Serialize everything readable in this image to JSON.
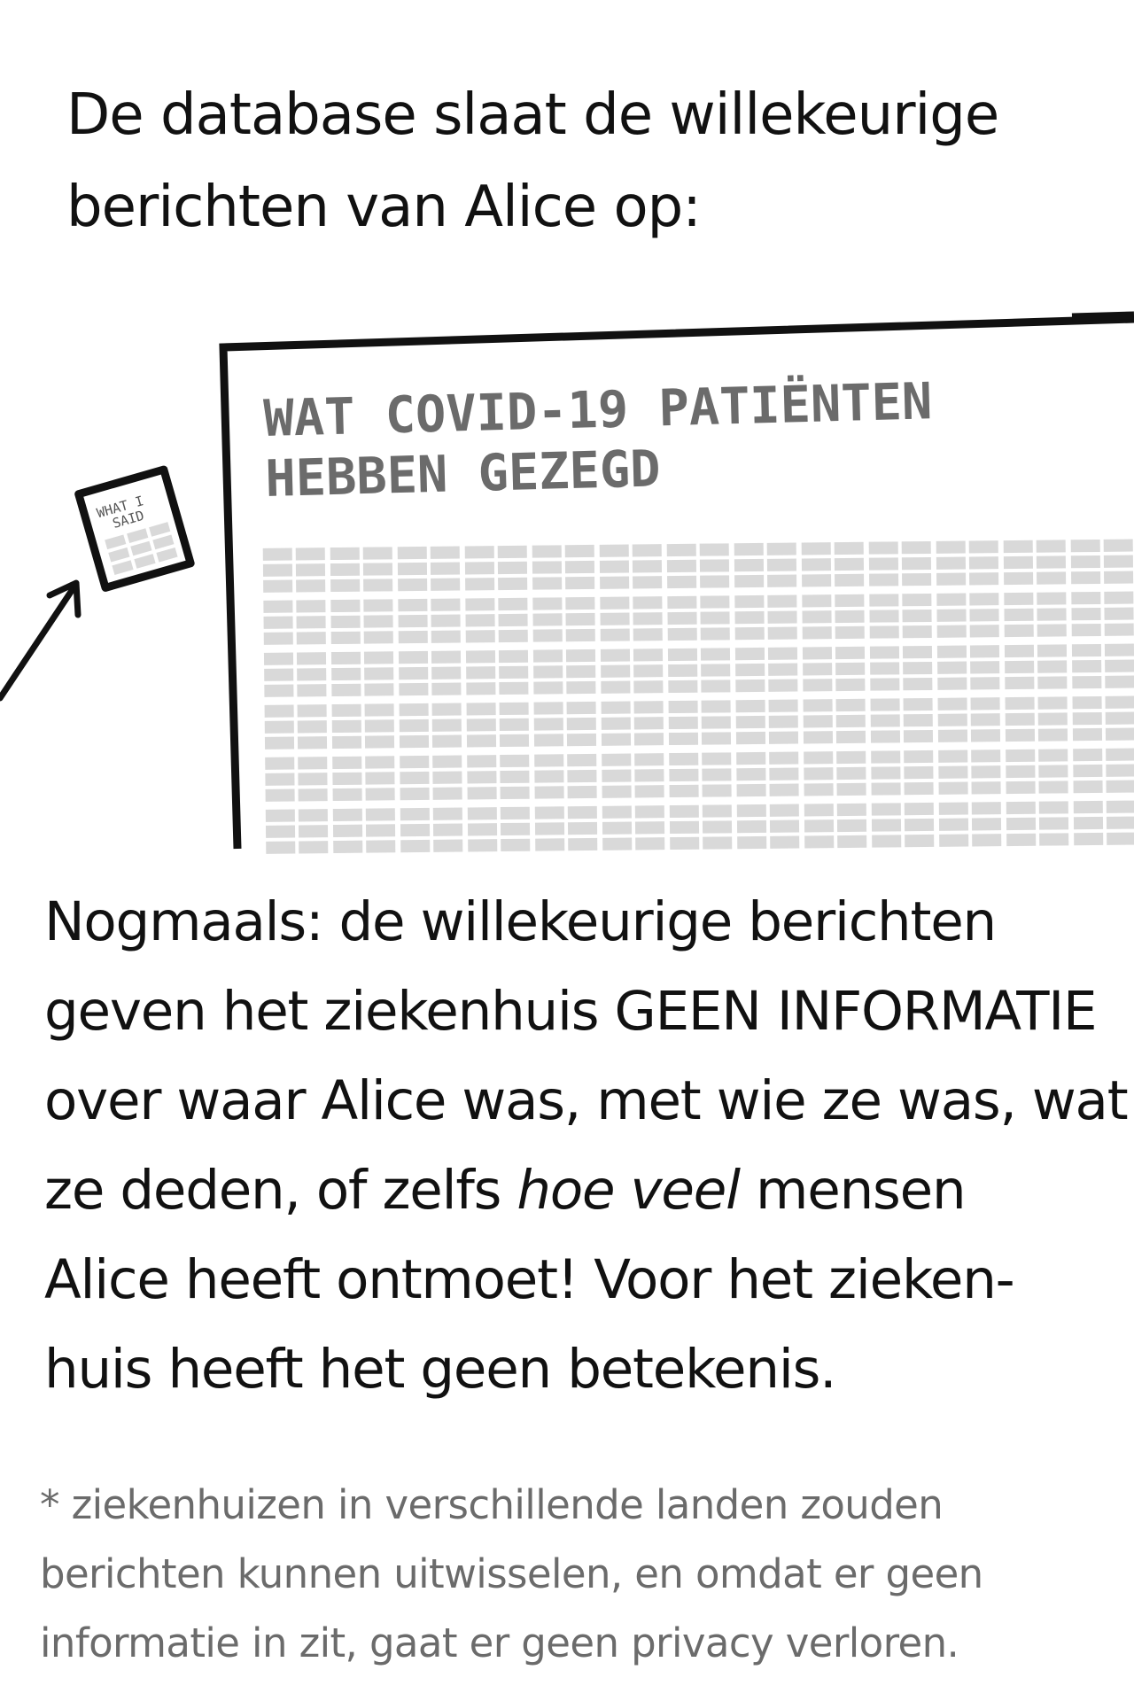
{
  "intro": {
    "line1": "De database slaat de willekeurige",
    "line2": "berichten van Alice op:"
  },
  "database": {
    "title_line1": "WAT COVID-19 PATIËNTEN",
    "title_line2": "HEBBEN GEZEGD"
  },
  "note": {
    "line1": "WHAT I",
    "line2": "SAID"
  },
  "main": {
    "line1": "Nogmaals: de willekeurige berichten",
    "line2": "geven het ziekenhuis GEEN INFORMATIE",
    "line3": "over waar Alice was, met wie ze was, wat",
    "line4_pre": "ze deden, of zelfs ",
    "line4_em": "hoe veel",
    "line4_post": " mensen",
    "line5": "Alice heeft ontmoet! Voor het zieken-",
    "line6": "huis heeft het geen betekenis."
  },
  "footnote": {
    "line1": "* ziekenhuizen in verschillende landen zouden",
    "line2": "berichten kunnen uitwisselen, en omdat er geen",
    "line3": "informatie in zit, gaat er geen privacy verloren."
  },
  "colors": {
    "ink": "#111111",
    "cell_gray": "#d9d9d9",
    "title_gray": "#6b6b6b",
    "footnote_gray": "#6b6b6b"
  },
  "icons": {
    "note": "paper-note-icon",
    "arrow": "arrow-icon"
  }
}
